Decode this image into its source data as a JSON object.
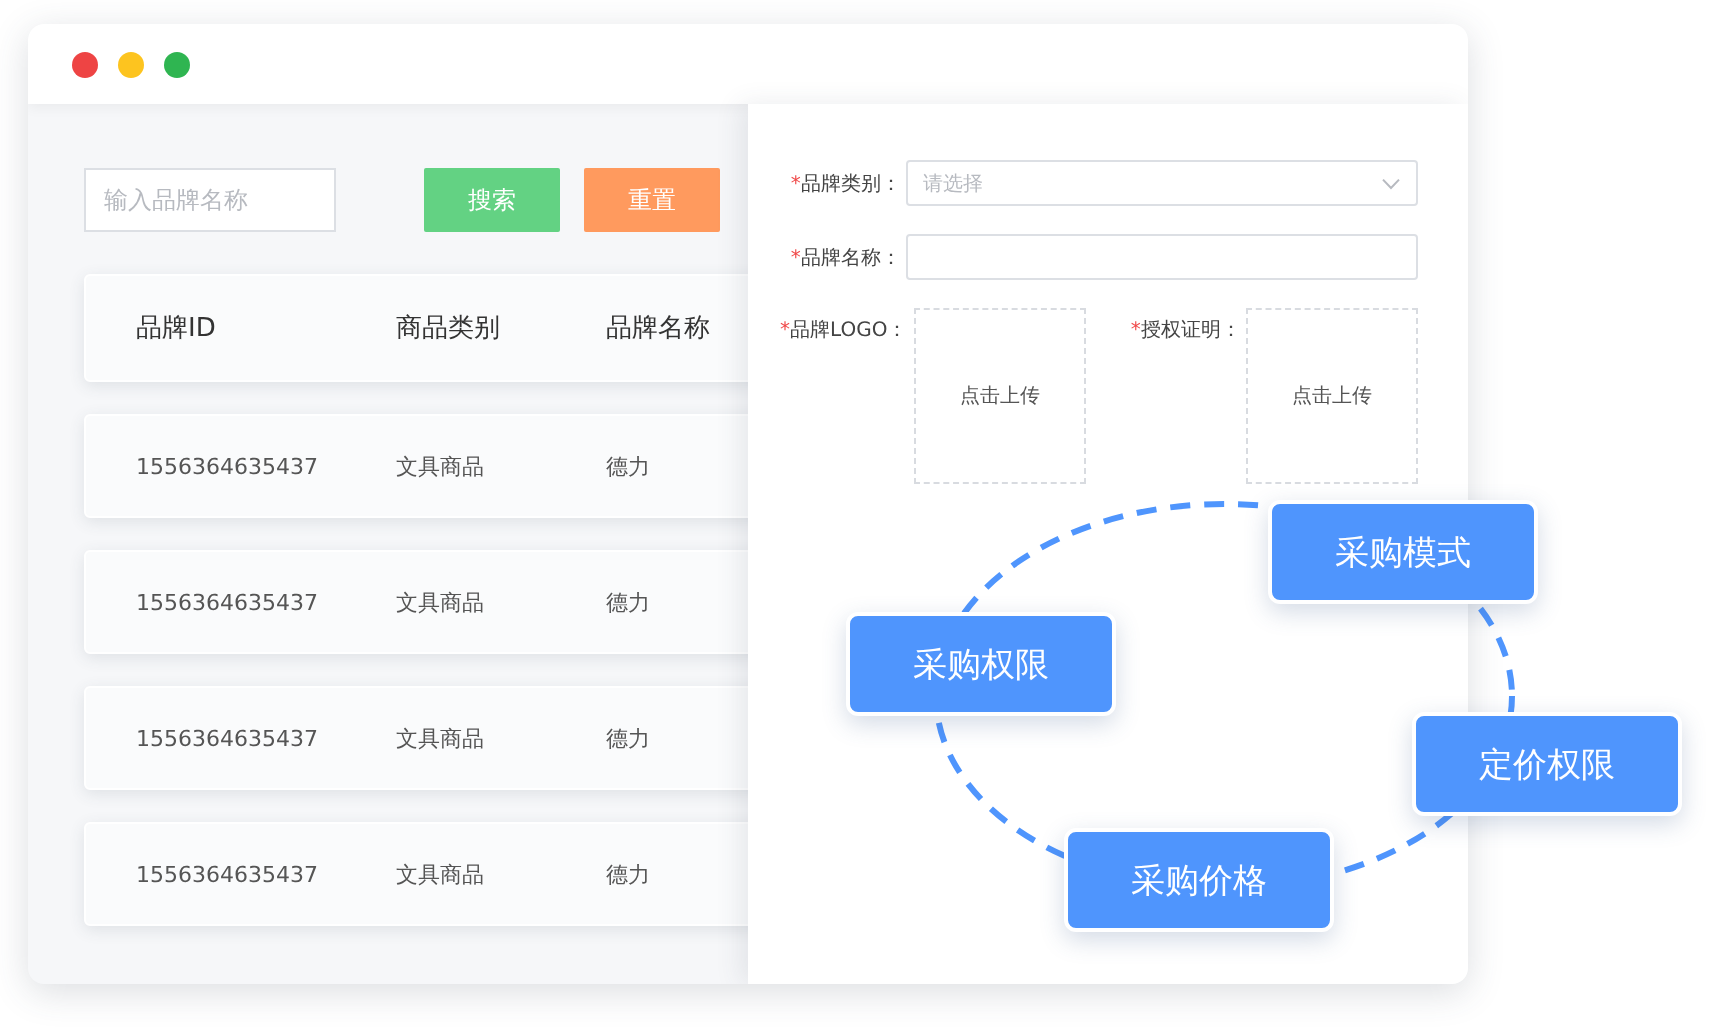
{
  "window": {
    "controls": [
      {
        "color": "#ee4444"
      },
      {
        "color": "#fdc41f"
      },
      {
        "color": "#2fb551"
      }
    ]
  },
  "search": {
    "placeholder": "输入品牌名称",
    "buttons": [
      {
        "label": "搜索",
        "kind": "search"
      },
      {
        "label": "重置",
        "kind": "reset"
      }
    ]
  },
  "table": {
    "columns": [
      "品牌ID",
      "商品类别",
      "品牌名称"
    ],
    "rows": [
      [
        "1556364635437",
        "文具商品",
        "德力"
      ],
      [
        "1556364635437",
        "文具商品",
        "德力"
      ],
      [
        "1556364635437",
        "文具商品",
        "德力"
      ],
      [
        "1556364635437",
        "文具商品",
        "德力"
      ]
    ]
  },
  "form": {
    "fields": [
      {
        "kind": "select",
        "mark": "*",
        "label": "品牌类别：",
        "placeholder": "请选择"
      },
      {
        "kind": "input",
        "mark": "*",
        "label": "品牌名称："
      }
    ],
    "uploads": [
      {
        "mark": "*",
        "label": "品牌LOGO：",
        "hint": "点击上传"
      },
      {
        "mark": "*",
        "label": "授权证明：",
        "hint": "点击上传"
      }
    ]
  },
  "diagram": {
    "nodes": [
      "采购模式",
      "采购权限",
      "定价权限",
      "采购价格"
    ]
  }
}
